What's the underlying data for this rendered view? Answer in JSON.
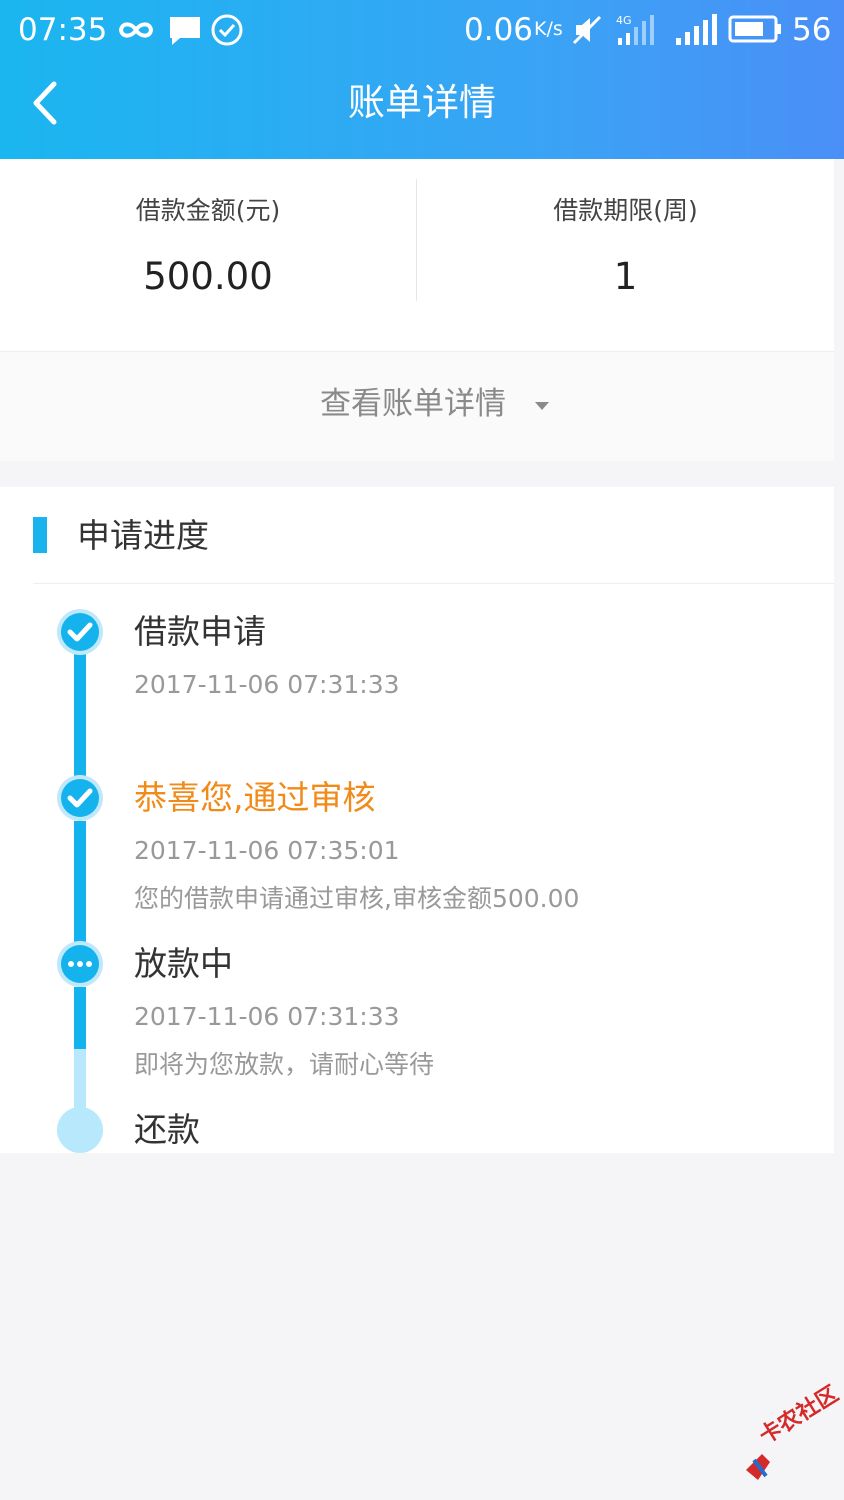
{
  "status_bar": {
    "time": "07:35",
    "network_speed": "0.06",
    "network_speed_unit": "K/s",
    "battery_level": "56",
    "icons": [
      "infinity-icon",
      "message-icon",
      "check-circle-icon",
      "mute-icon",
      "signal-4g-icon",
      "signal-icon",
      "battery-icon"
    ]
  },
  "nav": {
    "title": "账单详情",
    "back_icon": "chevron-left-icon"
  },
  "summary": {
    "amount_label": "借款金额(元)",
    "amount_value": "500.00",
    "term_label": "借款期限(周)",
    "term_value": "1",
    "view_detail_label": "查看账单详情",
    "view_detail_icon": "caret-down-icon"
  },
  "progress": {
    "title": "申请进度",
    "steps": [
      {
        "title": "借款申请",
        "time": "2017-11-06 07:31:33",
        "desc": "",
        "status": "done"
      },
      {
        "title": "恭喜您,通过审核",
        "time": "2017-11-06 07:35:01",
        "desc": "您的借款申请通过审核,审核金额500.00",
        "status": "done"
      },
      {
        "title": "放款中",
        "time": "2017-11-06 07:31:33",
        "desc": "即将为您放款，请耐心等待",
        "status": "in-progress"
      },
      {
        "title": "还款",
        "time": "",
        "desc": "",
        "status": "pending"
      }
    ]
  },
  "watermark": {
    "text": "卡农社区"
  },
  "colors": {
    "header_gradient_start": "#1ab6f0",
    "header_gradient_end": "#4a8ff7",
    "accent": "#14b3ee",
    "pending": "#b7e8fb",
    "highlight": "#f08a18",
    "muted_text": "#999999",
    "background": "#f5f5f7"
  }
}
